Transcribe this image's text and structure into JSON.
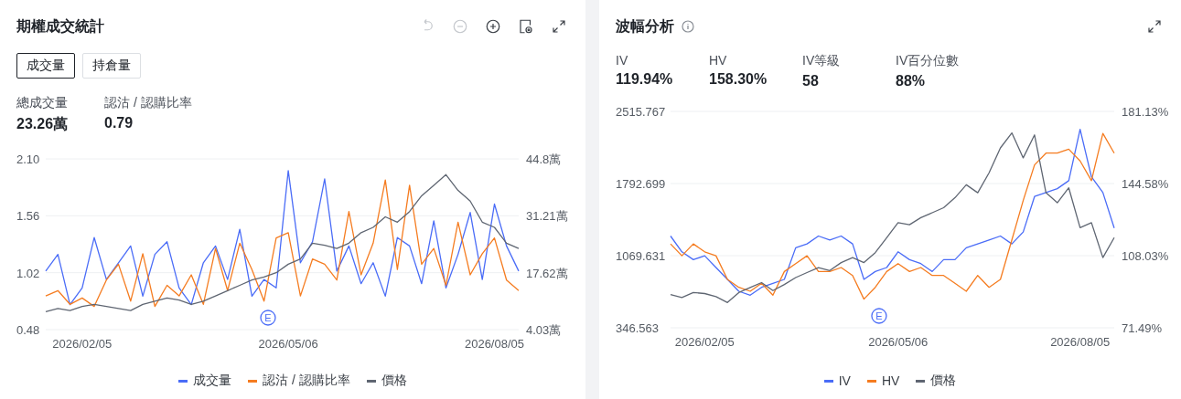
{
  "volume_panel": {
    "title": "期權成交統計",
    "toolbar": [
      {
        "kind": "undo",
        "disabled": true
      },
      {
        "kind": "zoom_out",
        "disabled": true
      },
      {
        "kind": "zoom_in",
        "disabled": false
      },
      {
        "kind": "settings",
        "disabled": false
      },
      {
        "kind": "expand",
        "disabled": false
      }
    ],
    "tabs": [
      {
        "label": "成交量",
        "selected": true
      },
      {
        "label": "持倉量",
        "selected": false
      }
    ],
    "stats": [
      {
        "label": "總成交量",
        "value": "23.26萬"
      },
      {
        "label": "認沽 / 認購比率",
        "value": "0.79"
      }
    ],
    "chart_data": {
      "type": "line",
      "ylim": [
        0.48,
        2.1
      ],
      "y2lim": [
        4.03,
        44.8
      ],
      "yticks": [
        {
          "value": 2.1,
          "label": "2.10"
        },
        {
          "value": 1.56,
          "label": "1.56"
        },
        {
          "value": 1.02,
          "label": "1.02"
        },
        {
          "value": 0.48,
          "label": "0.48"
        }
      ],
      "y2ticks": [
        {
          "value": 44.8,
          "label": "44.8萬"
        },
        {
          "value": 31.21,
          "label": "31.21萬"
        },
        {
          "value": 17.62,
          "label": "17.62萬"
        },
        {
          "value": 4.03,
          "label": "4.03萬"
        }
      ],
      "categories": [
        null,
        null,
        null,
        "2026/02/05",
        null,
        null,
        null,
        null,
        null,
        null,
        null,
        null,
        null,
        null,
        null,
        null,
        null,
        null,
        null,
        null,
        "2026/05/06",
        null,
        null,
        null,
        null,
        null,
        null,
        null,
        null,
        null,
        null,
        null,
        null,
        null,
        null,
        null,
        null,
        "2026/08/05",
        null,
        null
      ],
      "annotations": [
        "E"
      ],
      "series": [
        {
          "name": "成交量",
          "color": "#4a6cf7",
          "axis": "y2",
          "values": [
            18,
            22,
            10,
            14,
            26,
            16,
            20,
            24,
            12,
            22,
            25,
            14,
            10,
            20,
            24,
            16,
            28,
            12,
            16,
            14,
            42,
            20,
            25,
            40,
            18,
            24,
            15,
            20,
            12,
            26,
            24,
            15,
            30,
            14,
            22,
            32,
            16,
            34,
            24,
            18
          ]
        },
        {
          "name": "認沽 / 認購比率",
          "color": "#f57c20",
          "values": [
            0.8,
            0.85,
            0.72,
            0.78,
            0.7,
            0.95,
            1.1,
            0.75,
            1.2,
            0.7,
            0.9,
            0.8,
            1.0,
            0.72,
            1.25,
            0.85,
            1.3,
            1.05,
            0.75,
            1.35,
            1.4,
            0.8,
            1.15,
            1.1,
            0.95,
            1.6,
            1.0,
            1.3,
            1.9,
            1.05,
            1.85,
            1.1,
            1.25,
            0.9,
            1.5,
            1.0,
            1.2,
            1.35,
            0.95,
            0.85
          ]
        },
        {
          "name": "價格",
          "color": "#5f6672",
          "values": [
            0.65,
            0.68,
            0.66,
            0.7,
            0.72,
            0.7,
            0.68,
            0.66,
            0.72,
            0.75,
            0.78,
            0.76,
            0.72,
            0.75,
            0.8,
            0.85,
            0.9,
            0.95,
            0.98,
            1.02,
            1.1,
            1.15,
            1.3,
            1.28,
            1.25,
            1.3,
            1.4,
            1.45,
            1.55,
            1.5,
            1.6,
            1.75,
            1.85,
            1.95,
            1.8,
            1.7,
            1.5,
            1.45,
            1.3,
            1.25
          ]
        }
      ]
    }
  },
  "volatility_panel": {
    "title": "波幅分析",
    "stats": [
      {
        "label": "IV",
        "value": "119.94%"
      },
      {
        "label": "HV",
        "value": "158.30%"
      },
      {
        "label": "IV等級",
        "value": "58"
      },
      {
        "label": "IV百分位數",
        "value": "88%"
      }
    ],
    "chart_data": {
      "type": "line",
      "ylim": [
        346.563,
        2515.767
      ],
      "y2lim": [
        71.49,
        181.13
      ],
      "yticks": [
        {
          "value": 2515.767,
          "label": "2515.767"
        },
        {
          "value": 1792.699,
          "label": "1792.699"
        },
        {
          "value": 1069.631,
          "label": "1069.631"
        },
        {
          "value": 346.563,
          "label": "346.563"
        }
      ],
      "y2ticks": [
        {
          "value": 181.13,
          "label": "181.13%"
        },
        {
          "value": 144.58,
          "label": "144.58%"
        },
        {
          "value": 108.03,
          "label": "108.03%"
        },
        {
          "value": 71.49,
          "label": "71.49%"
        }
      ],
      "categories": [
        null,
        null,
        null,
        "2026/02/05",
        null,
        null,
        null,
        null,
        null,
        null,
        null,
        null,
        null,
        null,
        null,
        null,
        null,
        null,
        null,
        null,
        "2026/05/06",
        null,
        null,
        null,
        null,
        null,
        null,
        null,
        null,
        null,
        null,
        null,
        null,
        null,
        null,
        null,
        "2026/08/05",
        null,
        null,
        null
      ],
      "annotations": [
        "E"
      ],
      "series": [
        {
          "name": "IV",
          "color": "#4a6cf7",
          "axis": "y2",
          "values": [
            118,
            110,
            106,
            108,
            102,
            96,
            90,
            88,
            92,
            94,
            96,
            112,
            114,
            118,
            116,
            118,
            114,
            96,
            100,
            102,
            110,
            106,
            104,
            100,
            106,
            106,
            112,
            114,
            116,
            118,
            114,
            120,
            138,
            140,
            142,
            146,
            172,
            148,
            140,
            122
          ]
        },
        {
          "name": "HV",
          "color": "#f57c20",
          "axis": "y2",
          "values": [
            114,
            108,
            114,
            110,
            108,
            96,
            92,
            90,
            94,
            88,
            100,
            104,
            108,
            100,
            100,
            102,
            98,
            86,
            92,
            100,
            104,
            100,
            102,
            98,
            98,
            94,
            90,
            98,
            92,
            96,
            116,
            136,
            154,
            160,
            160,
            162,
            156,
            146,
            170,
            160
          ]
        },
        {
          "name": "價格",
          "color": "#5f6672",
          "values": [
            680,
            650,
            700,
            690,
            660,
            600,
            700,
            750,
            800,
            720,
            780,
            850,
            900,
            950,
            920,
            1000,
            1050,
            1000,
            1100,
            1250,
            1400,
            1380,
            1450,
            1500,
            1550,
            1650,
            1780,
            1700,
            1900,
            2150,
            2300,
            2050,
            2280,
            1700,
            1600,
            1750,
            1350,
            1400,
            1050,
            1250
          ]
        }
      ]
    }
  }
}
